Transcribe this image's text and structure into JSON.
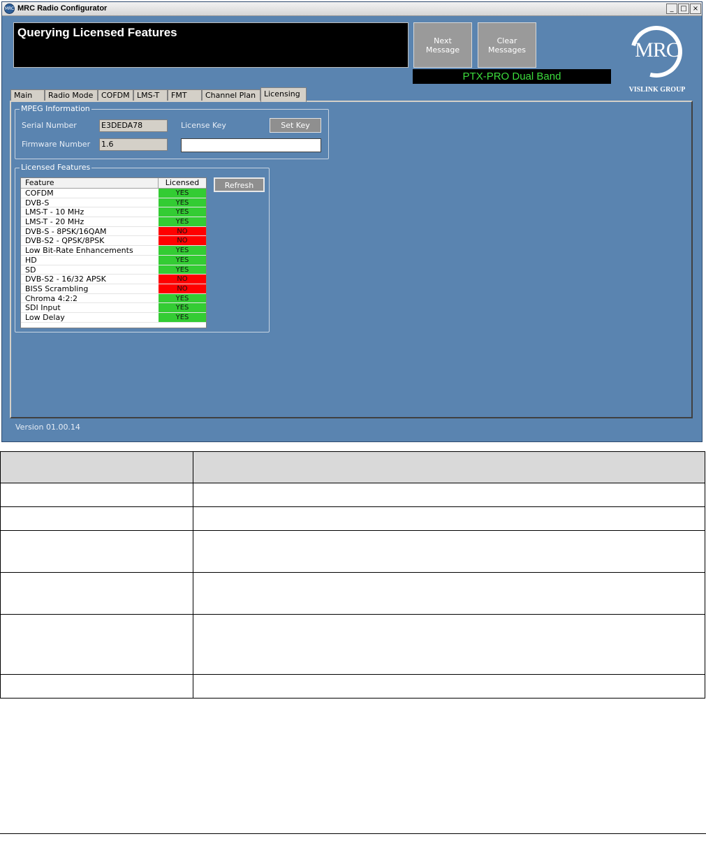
{
  "window": {
    "title": "MRC Radio Configurator",
    "icon_text": "MRC",
    "controls": [
      "_",
      "□",
      "×"
    ]
  },
  "header": {
    "message": "Querying Licensed Features",
    "next_message_button": "Next\nMessage",
    "clear_messages_button": "Clear\nMessages",
    "device_label": "PTX-PRO Dual Band",
    "device_label_color": "#3cdc3c",
    "logo_text": "MRC",
    "logo_subtext": "VISLINK GROUP"
  },
  "tabs": [
    {
      "label": "Main"
    },
    {
      "label": "Radio Mode"
    },
    {
      "label": "COFDM"
    },
    {
      "label": "LMS-T"
    },
    {
      "label": "FMT"
    },
    {
      "label": "Channel Plan"
    },
    {
      "label": "Licensing",
      "active": true
    }
  ],
  "mpeg": {
    "group_title": "MPEG Information",
    "serial_label": "Serial Number",
    "serial_value": "E3DEDA78",
    "firmware_label": "Firmware Number",
    "firmware_value": "1.6",
    "license_key_label": "License Key",
    "license_key_value": "",
    "set_key_button": "Set Key"
  },
  "licensed": {
    "group_title": "Licensed Features",
    "col_feature": "Feature",
    "col_licensed": "Licensed",
    "refresh_button": "Refresh",
    "yes_color": "#33cc33",
    "no_color": "#ff0000",
    "rows": [
      {
        "feature": "COFDM",
        "status": "YES"
      },
      {
        "feature": "DVB-S",
        "status": "YES"
      },
      {
        "feature": "LMS-T - 10 MHz",
        "status": "YES"
      },
      {
        "feature": "LMS-T - 20 MHz",
        "status": "YES"
      },
      {
        "feature": "DVB-S - 8PSK/16QAM",
        "status": "NO"
      },
      {
        "feature": "DVB-S2 - QPSK/8PSK",
        "status": "NO"
      },
      {
        "feature": "Low Bit-Rate Enhancements",
        "status": "YES"
      },
      {
        "feature": "HD",
        "status": "YES"
      },
      {
        "feature": "SD",
        "status": "YES"
      },
      {
        "feature": "DVB-S2 - 16/32 APSK",
        "status": "NO"
      },
      {
        "feature": "BISS Scrambling",
        "status": "NO"
      },
      {
        "feature": "Chroma 4:2:2",
        "status": "YES"
      },
      {
        "feature": "SDI Input",
        "status": "YES"
      },
      {
        "feature": "Low Delay",
        "status": "YES"
      }
    ]
  },
  "footer": {
    "version": "Version 01.00.14"
  }
}
